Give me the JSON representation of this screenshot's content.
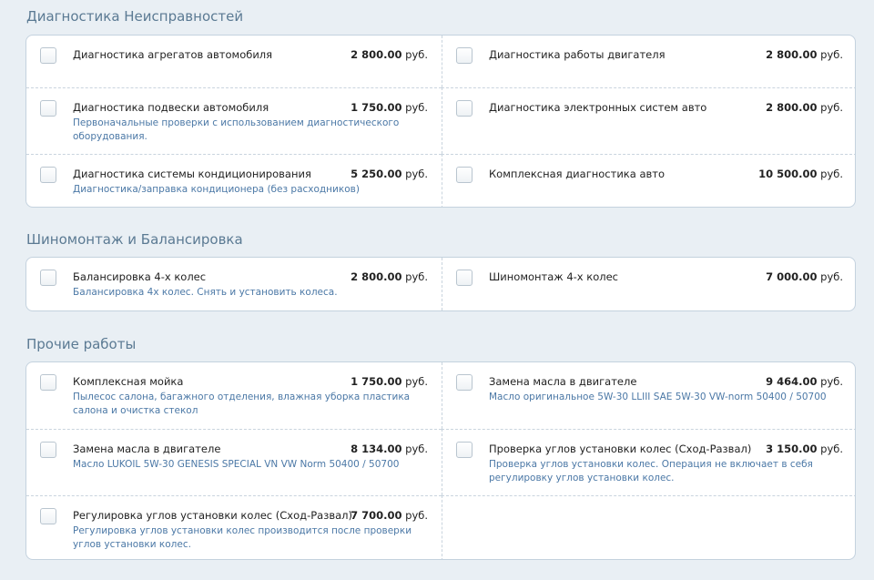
{
  "sections": [
    {
      "title": "Диагностика Неисправностей",
      "rows": [
        [
          {
            "name": "Диагностика агрегатов автомобиля",
            "price": "2 800.00",
            "currency": "руб.",
            "desc": ""
          },
          {
            "name": "Диагностика работы двигателя",
            "price": "2 800.00",
            "currency": "руб.",
            "desc": ""
          }
        ],
        [
          {
            "name": "Диагностика подвески автомобиля",
            "price": "1 750.00",
            "currency": "руб.",
            "desc": "Первоначальные проверки с использованием диагностического оборудования."
          },
          {
            "name": "Диагностика электронных систем авто",
            "price": "2 800.00",
            "currency": "руб.",
            "desc": ""
          }
        ],
        [
          {
            "name": "Диагностика системы кондиционирования",
            "price": "5 250.00",
            "currency": "руб.",
            "desc": "Диагностика/заправка кондиционера (без расходников)"
          },
          {
            "name": "Комплексная диагностика авто",
            "price": "10 500.00",
            "currency": "руб.",
            "desc": ""
          }
        ]
      ]
    },
    {
      "title": "Шиномонтаж и Балансировка",
      "rows": [
        [
          {
            "name": "Балансировка 4-х колес",
            "price": "2 800.00",
            "currency": "руб.",
            "desc": "Балансировка 4х колес. Снять и установить колеса."
          },
          {
            "name": "Шиномонтаж 4-х колес",
            "price": "7 000.00",
            "currency": "руб.",
            "desc": ""
          }
        ]
      ]
    },
    {
      "title": "Прочие работы",
      "rows": [
        [
          {
            "name": "Комплексная мойка",
            "price": "1 750.00",
            "currency": "руб.",
            "desc": "Пылесос салона, багажного отделения, влажная уборка пластика салона и очистка стекол"
          },
          {
            "name": "Замена масла в двигателе",
            "price": "9 464.00",
            "currency": "руб.",
            "desc": "Масло оригинальное 5W-30 LLIII SAE 5W-30 VW-norm 50400 / 50700"
          }
        ],
        [
          {
            "name": "Замена масла в двигателе",
            "price": "8 134.00",
            "currency": "руб.",
            "desc": "Масло LUKOIL 5W-30 GENESIS SPECIAL VN VW Norm 50400 / 50700"
          },
          {
            "name": "Проверка углов установки колес (Сход-Развал)",
            "price": "3 150.00",
            "currency": "руб.",
            "desc": "Проверка углов установки колес. Операция не включает в себя регулировку углов установки колес."
          }
        ],
        [
          {
            "name": "Регулировка углов установки колес (Сход-Развал)",
            "price": "7 700.00",
            "currency": "руб.",
            "desc": "Регулировка углов установки колес производится после проверки углов установки колес."
          },
          null
        ]
      ]
    }
  ]
}
